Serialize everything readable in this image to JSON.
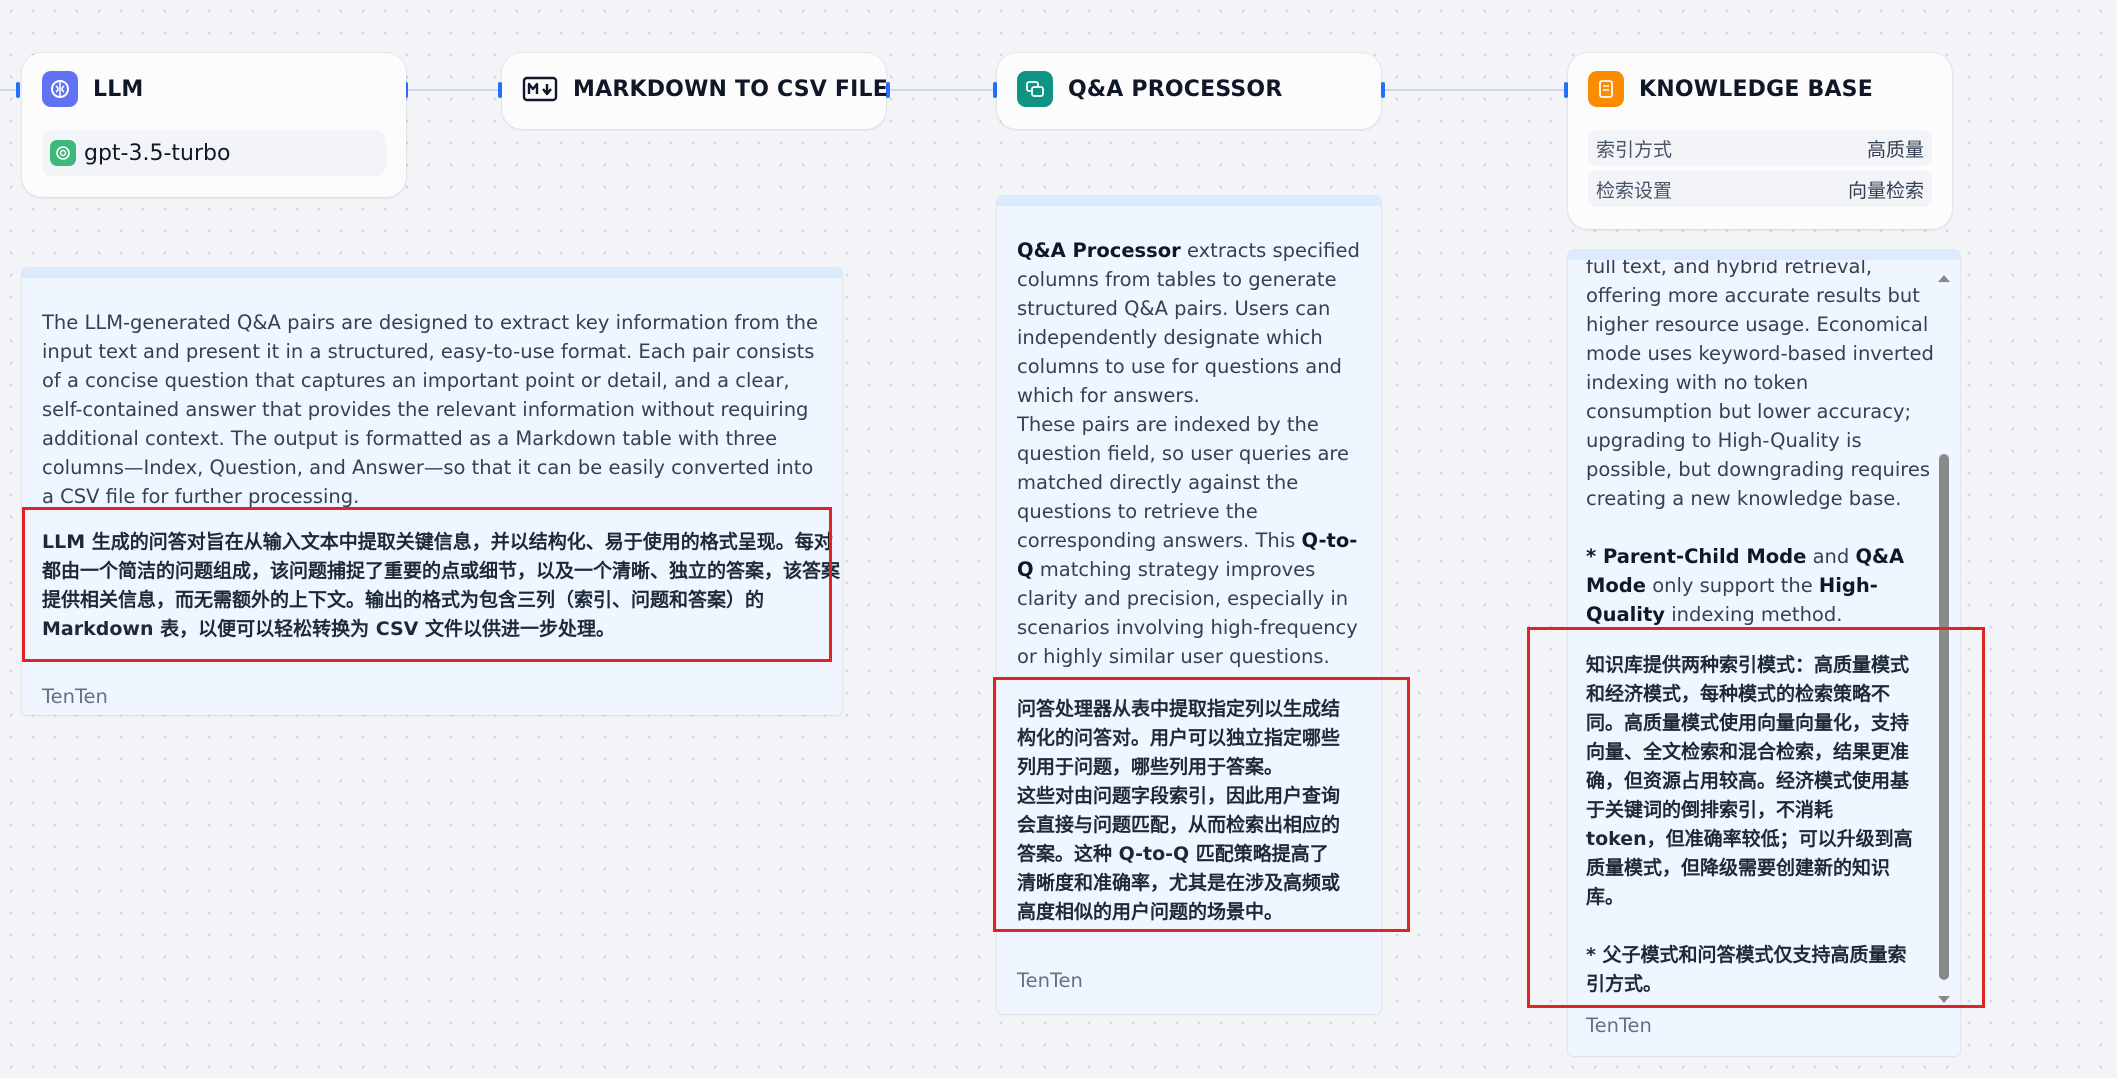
{
  "nodes": {
    "llm": {
      "title": "LLM",
      "model": "gpt-3.5-turbo",
      "icon": "brain-icon",
      "color": "#6172f3"
    },
    "markdown": {
      "title": "MARKDOWN TO CSV FILE",
      "icon": "markdown-icon"
    },
    "qa": {
      "title": "Q&A PROCESSOR",
      "icon": "chat-bubbles-icon",
      "color": "#0e9384"
    },
    "kb": {
      "title": "KNOWLEDGE BASE",
      "icon": "book-icon",
      "color": "#fb8c00",
      "rows": [
        {
          "label": "索引方式",
          "value": "高质量"
        },
        {
          "label": "检索设置",
          "value": "向量检索"
        }
      ]
    }
  },
  "notes": {
    "llm": {
      "en": "The LLM-generated Q&A pairs are designed to extract key information from the input text and present it in a structured, easy-to-use format. Each pair consists of a concise question that captures an important point or detail, and a clear, self-contained answer that provides the relevant information without requiring additional context. The output is formatted as a Markdown table with three columns—Index, Question, and Answer—so that it can be easily converted into a CSV file for further processing.",
      "zh": "LLM 生成的问答对旨在从输入文本中提取关键信息，并以结构化、易于使用的格式呈现。每对都由一个简洁的问题组成，该问题捕捉了重要的点或细节，以及一个清晰、独立的答案，该答案提供相关信息，而无需额外的上下文。输出的格式为包含三列（索引、问题和答案）的 Markdown 表，以便可以轻松转换为 CSV 文件以供进一步处理。",
      "author": "TenTen"
    },
    "qa": {
      "en_bold_1": "Q&A Processor",
      "en_1": " extracts specified columns from tables to generate structured Q&A pairs. Users can independently designate which columns to use for questions and which for answers.",
      "en_2": "These pairs are indexed by the question field, so user queries are matched directly against the questions to retrieve the corresponding answers. This ",
      "en_bold_2": "Q-to-Q",
      "en_3": " matching strategy improves clarity and precision, especially in scenarios involving high-frequency or highly similar user questions.",
      "zh_1": "问答处理器从表中提取指定列以生成结构化的问答对。用户可以独立指定哪些列用于问题，哪些列用于答案。",
      "zh_2": "这些对由问题字段索引，因此用户查询会直接与问题匹配，从而检索出相应的答案。这种 Q-to-Q 匹配策略提高了清晰度和准确率，尤其是在涉及高频或高度相似的用户问题的场景中。",
      "author": "TenTen"
    },
    "kb": {
      "en_partial": "full text, and hybrid retrieval,",
      "en_1": "offering more accurate results but higher resource usage. Economical mode uses keyword-based inverted indexing with no token consumption but lower accuracy; upgrading to High-Quality is possible, but downgrading requires creating a new knowledge base.",
      "en_2_prefix": "* ",
      "en_2_bold_1": "Parent-Child Mode",
      "en_2_mid_1": " and ",
      "en_2_bold_2": "Q&A Mode",
      "en_2_mid_2": " only support the ",
      "en_2_bold_3": "High-Quality",
      "en_2_end": " indexing method.",
      "zh_1": "知识库提供两种索引模式：高质量模式和经济模式，每种模式的检索策略不同。高质量模式使用向量向量化，支持向量、全文检索和混合检索，结果更准确，但资源占用较高。经济模式使用基于关键词的倒排索引，不消耗 token，但准确率较低；可以升级到高质量模式，但降级需要创建新的知识库。",
      "zh_2": "* 父子模式和问答模式仅支持高质量索引方式。",
      "author": "TenTen"
    }
  }
}
